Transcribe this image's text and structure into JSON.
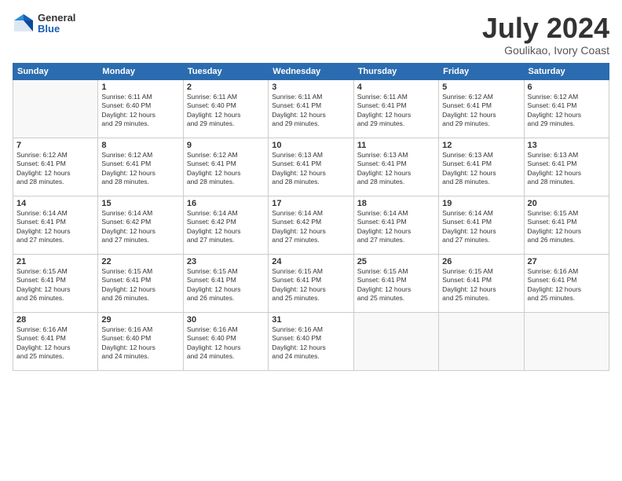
{
  "logo": {
    "general": "General",
    "blue": "Blue"
  },
  "title": "July 2024",
  "subtitle": "Goulikao, Ivory Coast",
  "days_of_week": [
    "Sunday",
    "Monday",
    "Tuesday",
    "Wednesday",
    "Thursday",
    "Friday",
    "Saturday"
  ],
  "weeks": [
    [
      {
        "day": "",
        "sunrise": "",
        "sunset": "",
        "daylight": "",
        "empty": true
      },
      {
        "day": "1",
        "sunrise": "Sunrise: 6:11 AM",
        "sunset": "Sunset: 6:40 PM",
        "daylight": "Daylight: 12 hours and 29 minutes."
      },
      {
        "day": "2",
        "sunrise": "Sunrise: 6:11 AM",
        "sunset": "Sunset: 6:40 PM",
        "daylight": "Daylight: 12 hours and 29 minutes."
      },
      {
        "day": "3",
        "sunrise": "Sunrise: 6:11 AM",
        "sunset": "Sunset: 6:41 PM",
        "daylight": "Daylight: 12 hours and 29 minutes."
      },
      {
        "day": "4",
        "sunrise": "Sunrise: 6:11 AM",
        "sunset": "Sunset: 6:41 PM",
        "daylight": "Daylight: 12 hours and 29 minutes."
      },
      {
        "day": "5",
        "sunrise": "Sunrise: 6:12 AM",
        "sunset": "Sunset: 6:41 PM",
        "daylight": "Daylight: 12 hours and 29 minutes."
      },
      {
        "day": "6",
        "sunrise": "Sunrise: 6:12 AM",
        "sunset": "Sunset: 6:41 PM",
        "daylight": "Daylight: 12 hours and 29 minutes."
      }
    ],
    [
      {
        "day": "7",
        "sunrise": "Sunrise: 6:12 AM",
        "sunset": "Sunset: 6:41 PM",
        "daylight": "Daylight: 12 hours and 28 minutes."
      },
      {
        "day": "8",
        "sunrise": "Sunrise: 6:12 AM",
        "sunset": "Sunset: 6:41 PM",
        "daylight": "Daylight: 12 hours and 28 minutes."
      },
      {
        "day": "9",
        "sunrise": "Sunrise: 6:12 AM",
        "sunset": "Sunset: 6:41 PM",
        "daylight": "Daylight: 12 hours and 28 minutes."
      },
      {
        "day": "10",
        "sunrise": "Sunrise: 6:13 AM",
        "sunset": "Sunset: 6:41 PM",
        "daylight": "Daylight: 12 hours and 28 minutes."
      },
      {
        "day": "11",
        "sunrise": "Sunrise: 6:13 AM",
        "sunset": "Sunset: 6:41 PM",
        "daylight": "Daylight: 12 hours and 28 minutes."
      },
      {
        "day": "12",
        "sunrise": "Sunrise: 6:13 AM",
        "sunset": "Sunset: 6:41 PM",
        "daylight": "Daylight: 12 hours and 28 minutes."
      },
      {
        "day": "13",
        "sunrise": "Sunrise: 6:13 AM",
        "sunset": "Sunset: 6:41 PM",
        "daylight": "Daylight: 12 hours and 28 minutes."
      }
    ],
    [
      {
        "day": "14",
        "sunrise": "Sunrise: 6:14 AM",
        "sunset": "Sunset: 6:41 PM",
        "daylight": "Daylight: 12 hours and 27 minutes."
      },
      {
        "day": "15",
        "sunrise": "Sunrise: 6:14 AM",
        "sunset": "Sunset: 6:42 PM",
        "daylight": "Daylight: 12 hours and 27 minutes."
      },
      {
        "day": "16",
        "sunrise": "Sunrise: 6:14 AM",
        "sunset": "Sunset: 6:42 PM",
        "daylight": "Daylight: 12 hours and 27 minutes."
      },
      {
        "day": "17",
        "sunrise": "Sunrise: 6:14 AM",
        "sunset": "Sunset: 6:42 PM",
        "daylight": "Daylight: 12 hours and 27 minutes."
      },
      {
        "day": "18",
        "sunrise": "Sunrise: 6:14 AM",
        "sunset": "Sunset: 6:41 PM",
        "daylight": "Daylight: 12 hours and 27 minutes."
      },
      {
        "day": "19",
        "sunrise": "Sunrise: 6:14 AM",
        "sunset": "Sunset: 6:41 PM",
        "daylight": "Daylight: 12 hours and 27 minutes."
      },
      {
        "day": "20",
        "sunrise": "Sunrise: 6:15 AM",
        "sunset": "Sunset: 6:41 PM",
        "daylight": "Daylight: 12 hours and 26 minutes."
      }
    ],
    [
      {
        "day": "21",
        "sunrise": "Sunrise: 6:15 AM",
        "sunset": "Sunset: 6:41 PM",
        "daylight": "Daylight: 12 hours and 26 minutes."
      },
      {
        "day": "22",
        "sunrise": "Sunrise: 6:15 AM",
        "sunset": "Sunset: 6:41 PM",
        "daylight": "Daylight: 12 hours and 26 minutes."
      },
      {
        "day": "23",
        "sunrise": "Sunrise: 6:15 AM",
        "sunset": "Sunset: 6:41 PM",
        "daylight": "Daylight: 12 hours and 26 minutes."
      },
      {
        "day": "24",
        "sunrise": "Sunrise: 6:15 AM",
        "sunset": "Sunset: 6:41 PM",
        "daylight": "Daylight: 12 hours and 25 minutes."
      },
      {
        "day": "25",
        "sunrise": "Sunrise: 6:15 AM",
        "sunset": "Sunset: 6:41 PM",
        "daylight": "Daylight: 12 hours and 25 minutes."
      },
      {
        "day": "26",
        "sunrise": "Sunrise: 6:15 AM",
        "sunset": "Sunset: 6:41 PM",
        "daylight": "Daylight: 12 hours and 25 minutes."
      },
      {
        "day": "27",
        "sunrise": "Sunrise: 6:16 AM",
        "sunset": "Sunset: 6:41 PM",
        "daylight": "Daylight: 12 hours and 25 minutes."
      }
    ],
    [
      {
        "day": "28",
        "sunrise": "Sunrise: 6:16 AM",
        "sunset": "Sunset: 6:41 PM",
        "daylight": "Daylight: 12 hours and 25 minutes."
      },
      {
        "day": "29",
        "sunrise": "Sunrise: 6:16 AM",
        "sunset": "Sunset: 6:40 PM",
        "daylight": "Daylight: 12 hours and 24 minutes."
      },
      {
        "day": "30",
        "sunrise": "Sunrise: 6:16 AM",
        "sunset": "Sunset: 6:40 PM",
        "daylight": "Daylight: 12 hours and 24 minutes."
      },
      {
        "day": "31",
        "sunrise": "Sunrise: 6:16 AM",
        "sunset": "Sunset: 6:40 PM",
        "daylight": "Daylight: 12 hours and 24 minutes."
      },
      {
        "day": "",
        "sunrise": "",
        "sunset": "",
        "daylight": "",
        "empty": true
      },
      {
        "day": "",
        "sunrise": "",
        "sunset": "",
        "daylight": "",
        "empty": true
      },
      {
        "day": "",
        "sunrise": "",
        "sunset": "",
        "daylight": "",
        "empty": true
      }
    ]
  ]
}
